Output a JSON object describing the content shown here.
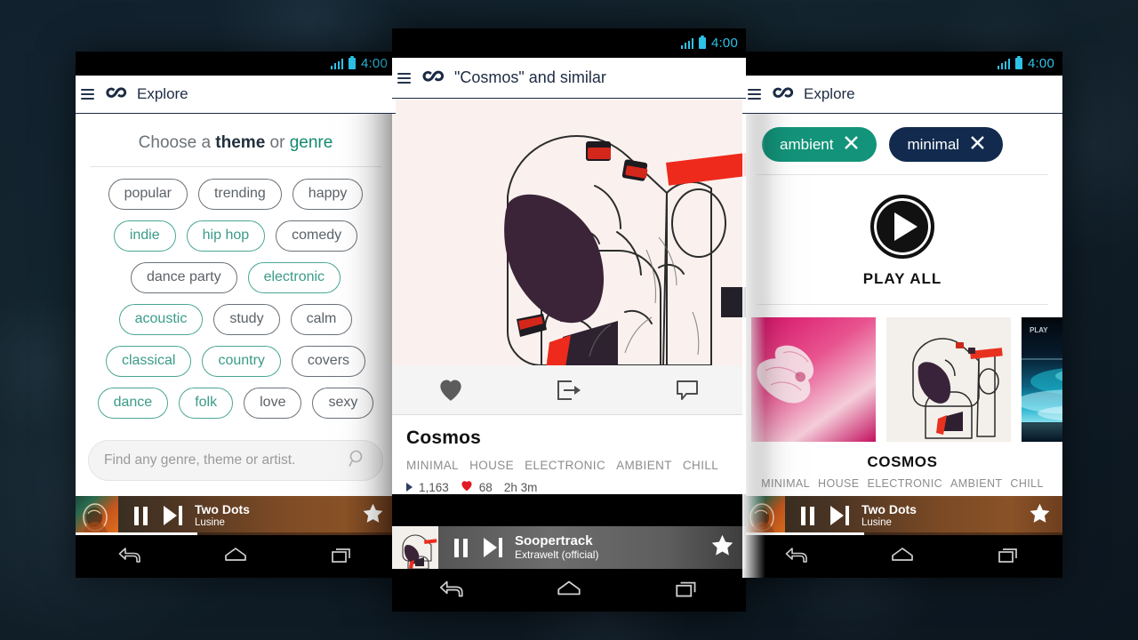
{
  "status_bar": {
    "time": "4:00"
  },
  "left_phone": {
    "appbar": {
      "title": "Explore"
    },
    "heading": {
      "pre": "Choose a ",
      "bold": "theme",
      "mid": " or ",
      "genre": "genre"
    },
    "tag_rows": [
      [
        {
          "label": "popular",
          "kind": "theme"
        },
        {
          "label": "trending",
          "kind": "theme"
        },
        {
          "label": "happy",
          "kind": "theme"
        }
      ],
      [
        {
          "label": "indie",
          "kind": "genre"
        },
        {
          "label": "hip hop",
          "kind": "genre"
        },
        {
          "label": "comedy",
          "kind": "theme"
        }
      ],
      [
        {
          "label": "dance party",
          "kind": "theme"
        },
        {
          "label": "electronic",
          "kind": "genre"
        }
      ],
      [
        {
          "label": "acoustic",
          "kind": "genre"
        },
        {
          "label": "study",
          "kind": "theme"
        },
        {
          "label": "calm",
          "kind": "theme"
        }
      ],
      [
        {
          "label": "classical",
          "kind": "genre"
        },
        {
          "label": "country",
          "kind": "genre"
        },
        {
          "label": "covers",
          "kind": "theme"
        }
      ],
      [
        {
          "label": "dance",
          "kind": "genre"
        },
        {
          "label": "folk",
          "kind": "genre"
        },
        {
          "label": "love",
          "kind": "theme"
        },
        {
          "label": "sexy",
          "kind": "theme"
        }
      ]
    ],
    "search": {
      "placeholder": "Find any genre, theme or artist."
    },
    "player": {
      "track": "Two Dots",
      "artist": "Lusine",
      "progress_pct": 38
    }
  },
  "center_phone": {
    "appbar": {
      "title": "\"Cosmos\" and similar"
    },
    "actions": [
      {
        "name": "like",
        "icon": "heart-icon"
      },
      {
        "name": "share",
        "icon": "share-icon"
      },
      {
        "name": "comment",
        "icon": "comment-icon"
      }
    ],
    "mix": {
      "title": "Cosmos",
      "tags": [
        "MINIMAL",
        "HOUSE",
        "ELECTRONIC",
        "AMBIENT",
        "CHILL"
      ],
      "plays": "1,163",
      "likes": "68",
      "duration": "2h 3m"
    },
    "player": {
      "track": "Soopertrack",
      "artist": "Extrawelt (official)",
      "progress_pct": 0
    }
  },
  "right_phone": {
    "appbar": {
      "title": "Explore"
    },
    "filters": [
      {
        "label": "ambient",
        "color": "#13947a"
      },
      {
        "label": "minimal",
        "color": "#112a4e"
      }
    ],
    "play_all": {
      "label": "PLAY ALL"
    },
    "grid_caption": {
      "title": "COSMOS",
      "tags": [
        "MINIMAL",
        "HOUSE",
        "ELECTRONIC",
        "AMBIENT",
        "CHILL"
      ]
    },
    "player": {
      "track": "Two Dots",
      "artist": "Lusine",
      "progress_pct": 38
    }
  }
}
